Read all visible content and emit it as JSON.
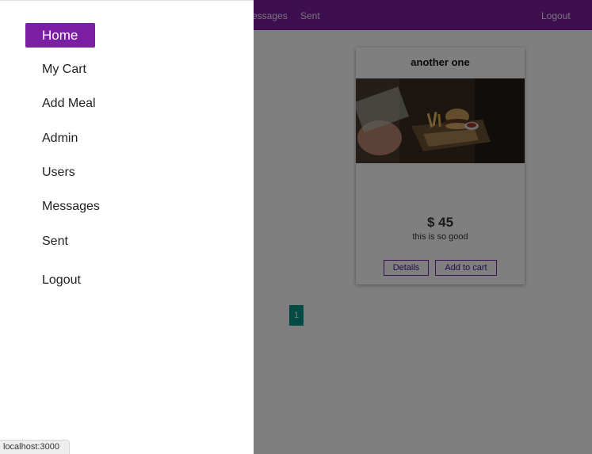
{
  "colors": {
    "navbar": "#7b1fa2",
    "accent": "#7b1fa2",
    "pagination": "#009688",
    "overlay": "rgba(0,0,0,0.5)"
  },
  "topbar": {
    "links": [
      "essages",
      "Sent"
    ],
    "logout_label": "Logout"
  },
  "card": {
    "title": "another one",
    "price": "$ 45",
    "description": "this is so good",
    "details_label": "Details",
    "add_to_cart_label": "Add to cart"
  },
  "pagination": {
    "current_page": "1"
  },
  "drawer": {
    "items": [
      {
        "label": "Home",
        "active": true
      },
      {
        "label": "My Cart"
      },
      {
        "label": "Add Meal"
      },
      {
        "label": "Admin"
      },
      {
        "label": "Users"
      },
      {
        "label": "Messages"
      },
      {
        "label": "Sent"
      },
      {
        "label": "Logout"
      }
    ]
  },
  "status_bar": {
    "url": "localhost:3000"
  }
}
